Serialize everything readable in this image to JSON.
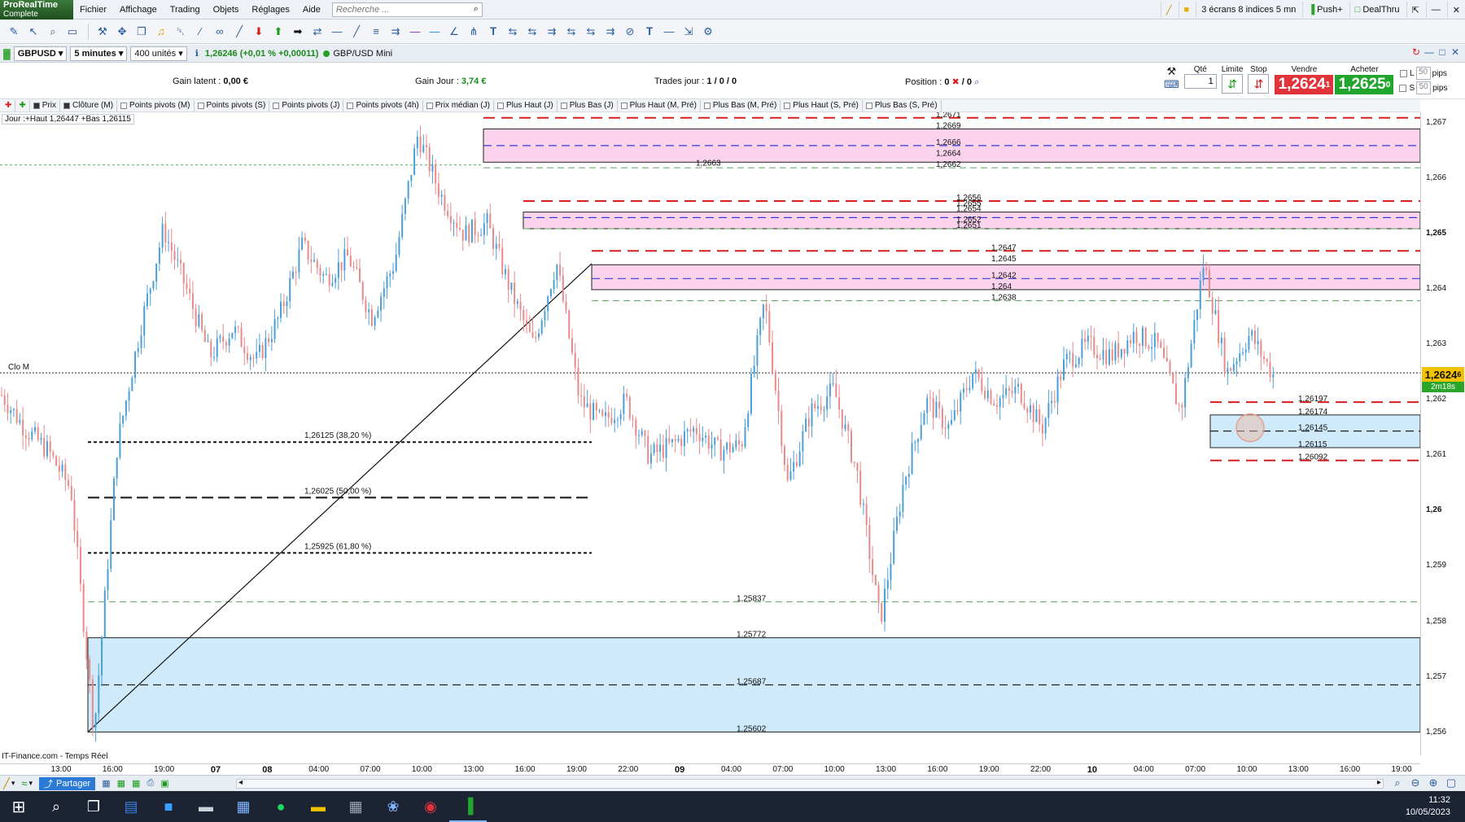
{
  "app": {
    "logo_line1": "ProRealTime",
    "logo_line2": "Complete",
    "menu": [
      "Fichier",
      "Affichage",
      "Trading",
      "Objets",
      "Réglages",
      "Aide"
    ],
    "search_placeholder": "Recherche ...",
    "right_buttons": {
      "layout": "3 écrans 8 indices 5 mn",
      "push": "Push+",
      "dealthru": "DealThru"
    }
  },
  "instrument": {
    "symbol": "GBPUSD",
    "timeframe": "5 minutes",
    "units": "400 unités",
    "price_info": "1,26246 (+0,01 % +0,00011)",
    "name": "GBP/USD Mini"
  },
  "info": {
    "gain_latent_label": "Gain latent :",
    "gain_latent_value": "0,00 €",
    "gain_jour_label": "Gain Jour :",
    "gain_jour_value": "3,74 €",
    "trades_label": "Trades jour :",
    "trades_value": "1 / 0 / 0",
    "position_label": "Position :",
    "position_value": "0",
    "position_value2": "/ 0"
  },
  "order": {
    "qty_label": "Qté",
    "qty_value": "1",
    "limit_label": "Limite",
    "stop_label": "Stop",
    "sell_label": "Vendre",
    "buy_label": "Acheter",
    "sell_price": "1,2624",
    "sell_sup": "1",
    "buy_price": "1,2625",
    "buy_sup": "0",
    "l_label": "L",
    "s_label": "S",
    "pips_value": "50",
    "pips_label": "pips"
  },
  "indicators": [
    {
      "label": "Prix",
      "on": true
    },
    {
      "label": "Clôture (M)",
      "on": true
    },
    {
      "label": "Points pivots (M)",
      "on": false
    },
    {
      "label": "Points pivots (S)",
      "on": false
    },
    {
      "label": "Points pivots (J)",
      "on": false
    },
    {
      "label": "Points pivots (4h)",
      "on": false
    },
    {
      "label": "Prix médian (J)",
      "on": false
    },
    {
      "label": "Plus Haut (J)",
      "on": false
    },
    {
      "label": "Plus Bas (J)",
      "on": false
    },
    {
      "label": "Plus Haut (M, Pré)",
      "on": false
    },
    {
      "label": "Plus Bas (M, Pré)",
      "on": false
    },
    {
      "label": "Plus Haut (S, Pré)",
      "on": false
    },
    {
      "label": "Plus Bas (S, Pré)",
      "on": false
    }
  ],
  "day_label": "Jour :+Haut 1,26447 +Bas 1,26115",
  "clo_label": "Clo M",
  "footer_note": "IT-Finance.com - Temps Réel",
  "price_axis": {
    "ticks": [
      {
        "v": 1.267,
        "label": "1,267",
        "bold": false
      },
      {
        "v": 1.266,
        "label": "1,266",
        "bold": false
      },
      {
        "v": 1.265,
        "label": "1,265",
        "bold": true
      },
      {
        "v": 1.264,
        "label": "1,264",
        "bold": false
      },
      {
        "v": 1.263,
        "label": "1,263",
        "bold": false
      },
      {
        "v": 1.262,
        "label": "1,262",
        "bold": false
      },
      {
        "v": 1.261,
        "label": "1,261",
        "bold": false
      },
      {
        "v": 1.26,
        "label": "1,26",
        "bold": true
      },
      {
        "v": 1.259,
        "label": "1,259",
        "bold": false
      },
      {
        "v": 1.258,
        "label": "1,258",
        "bold": false
      },
      {
        "v": 1.257,
        "label": "1,257",
        "bold": false
      },
      {
        "v": 1.256,
        "label": "1,256",
        "bold": false
      }
    ],
    "current_price": "1,2624",
    "current_sup": "6",
    "timer": "2m18s"
  },
  "time_axis": [
    {
      "label": "13:00",
      "bold": false
    },
    {
      "label": "16:00",
      "bold": false
    },
    {
      "label": "19:00",
      "bold": false
    },
    {
      "label": "07",
      "bold": true
    },
    {
      "label": "08",
      "bold": true
    },
    {
      "label": "04:00",
      "bold": false
    },
    {
      "label": "07:00",
      "bold": false
    },
    {
      "label": "10:00",
      "bold": false
    },
    {
      "label": "13:00",
      "bold": false
    },
    {
      "label": "16:00",
      "bold": false
    },
    {
      "label": "19:00",
      "bold": false
    },
    {
      "label": "22:00",
      "bold": false
    },
    {
      "label": "09",
      "bold": true
    },
    {
      "label": "04:00",
      "bold": false
    },
    {
      "label": "07:00",
      "bold": false
    },
    {
      "label": "10:00",
      "bold": false
    },
    {
      "label": "13:00",
      "bold": false
    },
    {
      "label": "16:00",
      "bold": false
    },
    {
      "label": "19:00",
      "bold": false
    },
    {
      "label": "22:00",
      "bold": false
    },
    {
      "label": "10",
      "bold": true
    },
    {
      "label": "04:00",
      "bold": false
    },
    {
      "label": "07:00",
      "bold": false
    },
    {
      "label": "10:00",
      "bold": false
    },
    {
      "label": "13:00",
      "bold": false
    },
    {
      "label": "16:00",
      "bold": false
    },
    {
      "label": "19:00",
      "bold": false
    }
  ],
  "chart_data": {
    "type": "candlestick",
    "y_range": [
      1.2556,
      1.2672
    ],
    "zones": [
      {
        "top": 1.2669,
        "bottom": 1.2663,
        "color": "#fbd3ec",
        "mid": 1.2666,
        "labels": [
          {
            "v": 1.2671,
            "t": "1,2671"
          },
          {
            "v": 1.2669,
            "t": "1,2669"
          },
          {
            "v": 1.2666,
            "t": "1,2666"
          },
          {
            "v": 1.2664,
            "t": "1,2664"
          },
          {
            "v": 1.2662,
            "t": "1,2662"
          }
        ],
        "extra_label": {
          "v": 1.2663,
          "t": "1,2663"
        }
      },
      {
        "top": 1.2654,
        "bottom": 1.2651,
        "color": "#fbd3ec",
        "mid": 1.2653,
        "labels": [
          {
            "v": 1.2656,
            "t": "1,2656"
          },
          {
            "v": 1.2655,
            "t": "1,2655"
          },
          {
            "v": 1.2654,
            "t": "1,2654"
          },
          {
            "v": 1.2652,
            "t": "1,2652"
          },
          {
            "v": 1.2651,
            "t": "1,2651"
          }
        ]
      },
      {
        "top": 1.26445,
        "bottom": 1.264,
        "color": "#fbd3ec",
        "mid": 1.2642,
        "labels": [
          {
            "v": 1.2647,
            "t": "1,2647"
          },
          {
            "v": 1.2645,
            "t": "1,2645"
          },
          {
            "v": 1.2642,
            "t": "1,2642"
          },
          {
            "v": 1.264,
            "t": "1,264"
          },
          {
            "v": 1.2638,
            "t": "1,2638"
          }
        ]
      },
      {
        "top": 1.26174,
        "bottom": 1.26115,
        "color": "#cfeafa",
        "mid": 1.26145,
        "labels": [
          {
            "v": 1.26197,
            "t": "1,26197"
          },
          {
            "v": 1.26174,
            "t": "1,26174"
          },
          {
            "v": 1.26145,
            "t": "1,26145"
          },
          {
            "v": 1.26115,
            "t": "1,26115"
          },
          {
            "v": 1.26092,
            "t": "1,26092"
          }
        ]
      },
      {
        "top": 1.25772,
        "bottom": 1.25602,
        "color": "#cfeafa",
        "mid": 1.25687,
        "labels": [
          {
            "v": 1.25837,
            "t": "1,25837"
          },
          {
            "v": 1.25772,
            "t": "1,25772"
          },
          {
            "v": 1.25687,
            "t": "1,25687"
          },
          {
            "v": 1.25602,
            "t": "1,25602"
          }
        ]
      }
    ],
    "fibonacci": [
      {
        "v": 1.26125,
        "label": "1,26125 (38,20 %)"
      },
      {
        "v": 1.26025,
        "label": "1,26025 (50,00 %)"
      },
      {
        "v": 1.25925,
        "label": "1,25925 (61,80 %)"
      }
    ],
    "clo_m": 1.2625,
    "trend_line": {
      "from": 1.25602,
      "to": 1.26447
    },
    "candles": {
      "open": 1.2618,
      "close": 1.26246,
      "high": 1.26447,
      "low": 1.2578,
      "anchors": [
        1.2621,
        1.2615,
        1.2611,
        1.2604,
        1.25602,
        1.2612,
        1.2633,
        1.2651,
        1.264,
        1.2628,
        1.2633,
        1.2627,
        1.2635,
        1.2648,
        1.2642,
        1.2646,
        1.2635,
        1.2645,
        1.2668,
        1.2657,
        1.265,
        1.2652,
        1.264,
        1.263,
        1.2645,
        1.262,
        1.2616,
        1.262,
        1.261,
        1.2612,
        1.2615,
        1.2611,
        1.2612,
        1.2638,
        1.2605,
        1.2618,
        1.2622,
        1.2607,
        1.258,
        1.2605,
        1.262,
        1.2615,
        1.2625,
        1.262,
        1.2622,
        1.2615,
        1.2627,
        1.263,
        1.2628,
        1.2632,
        1.263,
        1.2618,
        1.2645,
        1.2625,
        1.2632,
        1.26246
      ]
    }
  },
  "bottom": {
    "share_label": "Partager"
  },
  "taskbar": {
    "time": "11:32",
    "date": "10/05/2023"
  }
}
